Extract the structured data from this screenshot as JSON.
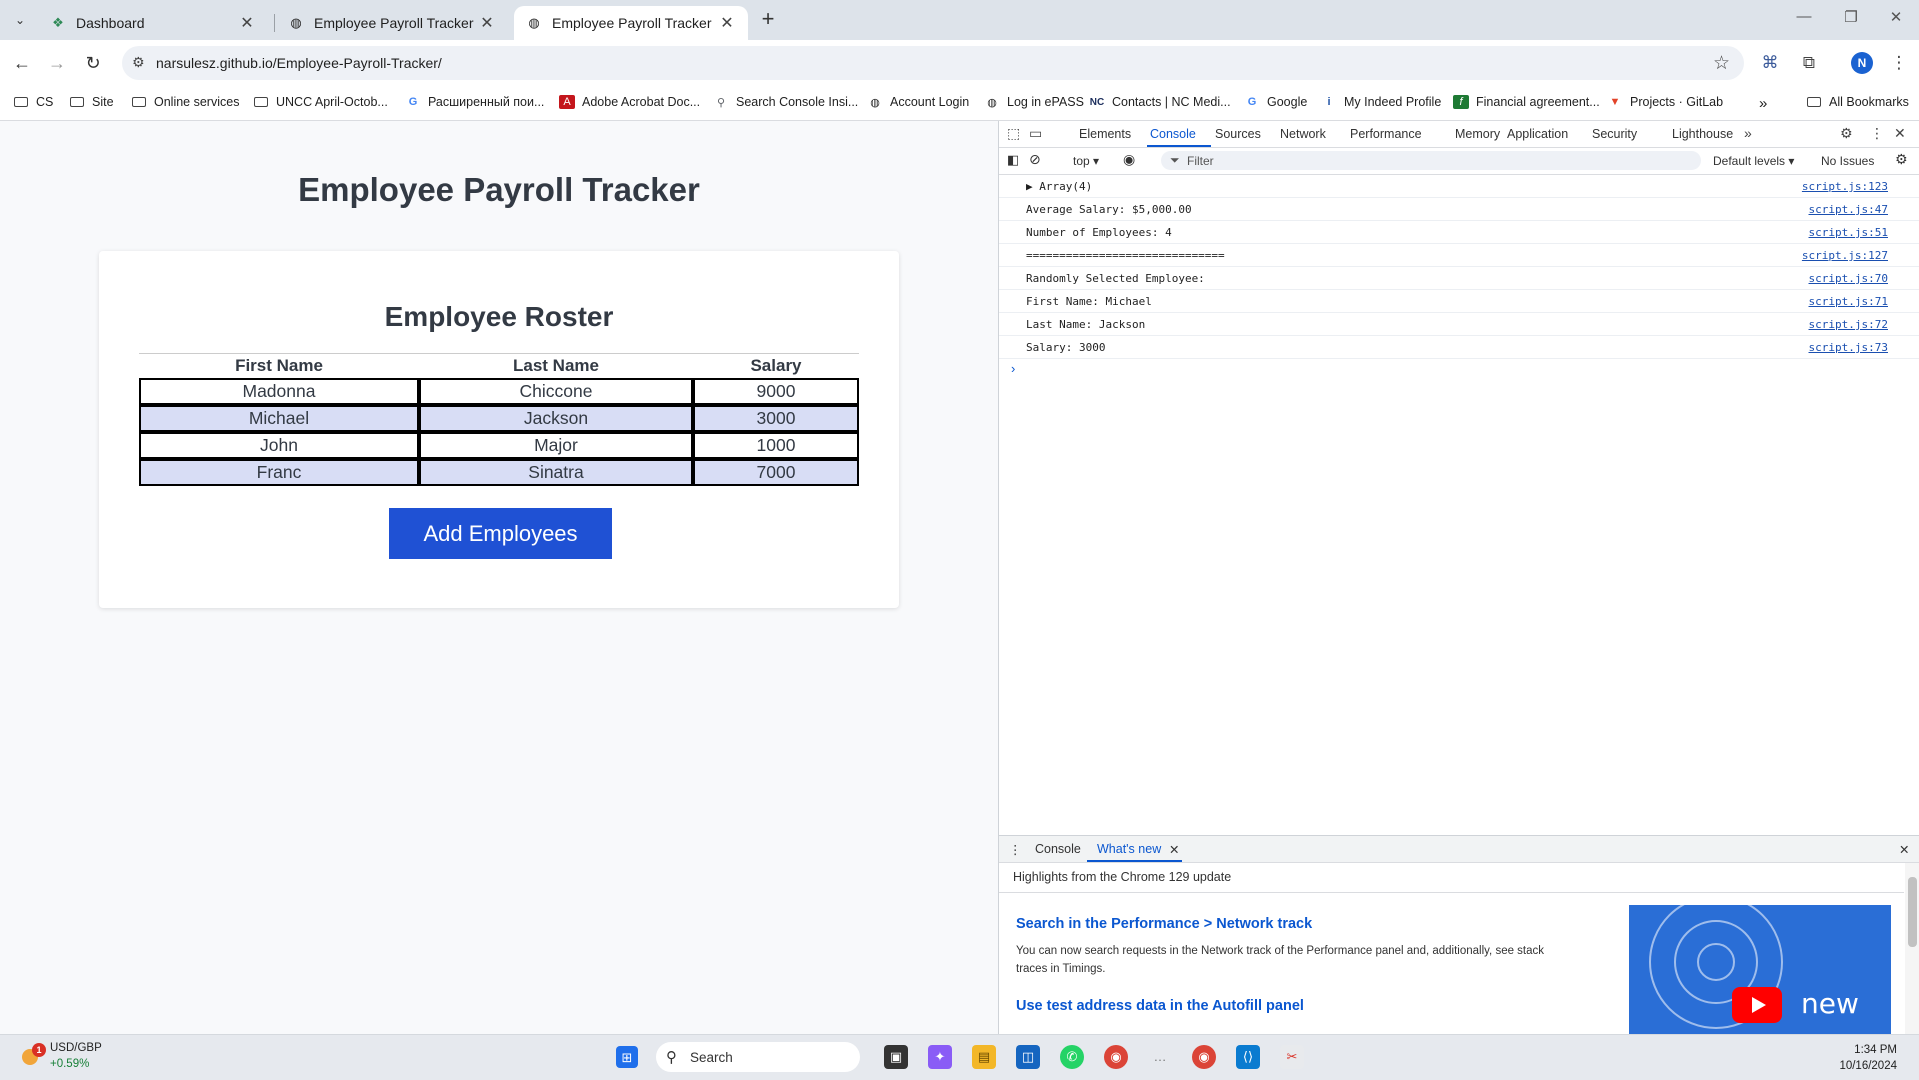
{
  "browser": {
    "tabs": [
      {
        "label": "Dashboard",
        "icon": "dashboard-favicon"
      },
      {
        "label": "Employee Payroll Tracker",
        "icon": "globe-icon"
      },
      {
        "label": "Employee Payroll Tracker",
        "icon": "globe-icon",
        "active": true
      }
    ],
    "url": "narsulesz.github.io/Employee-Payroll-Tracker/",
    "profile_initial": "N",
    "bookmarks": [
      "CS",
      "Site",
      "Online services",
      "UNCC April-Octob...",
      "Расширенный пои...",
      "Adobe Acrobat Doc...",
      "Search Console Insi...",
      "Account Login",
      "Log in ePASS",
      "Contacts | NC Medi...",
      "Google",
      "My Indeed Profile",
      "Financial agreement...",
      "Projects · GitLab"
    ],
    "all_bookmarks": "All Bookmarks"
  },
  "page": {
    "title": "Employee Payroll Tracker",
    "card_title": "Employee Roster",
    "columns": [
      "First Name",
      "Last Name",
      "Salary"
    ],
    "rows": [
      [
        "Madonna",
        "Chiccone",
        "9000"
      ],
      [
        "Michael",
        "Jackson",
        "3000"
      ],
      [
        "John",
        "Major",
        "1000"
      ],
      [
        "Franc",
        "Sinatra",
        "7000"
      ]
    ],
    "add_button": "Add Employees"
  },
  "devtools": {
    "tabs": [
      "Elements",
      "Console",
      "Sources",
      "Network",
      "Performance",
      "Memory",
      "Application",
      "Security",
      "Lighthouse"
    ],
    "active_tab": "Console",
    "context": "top",
    "filter_placeholder": "Filter",
    "levels": "Default levels",
    "issues": "No Issues",
    "console_lines": [
      {
        "msg": "▶ Array(4)",
        "src": "script.js:123"
      },
      {
        "msg": "Average Salary: $5,000.00",
        "src": "script.js:47"
      },
      {
        "msg": "Number of Employees: 4",
        "src": "script.js:51"
      },
      {
        "msg": "==============================",
        "src": "script.js:127"
      },
      {
        "msg": "Randomly Selected Employee:",
        "src": "script.js:70"
      },
      {
        "msg": "First Name: Michael",
        "src": "script.js:71"
      },
      {
        "msg": "Last Name: Jackson",
        "src": "script.js:72"
      },
      {
        "msg": "Salary: 3000",
        "src": "script.js:73"
      }
    ],
    "drawer": {
      "tabs": [
        "Console",
        "What's new"
      ],
      "header": "Highlights from the Chrome 129 update",
      "items": [
        {
          "title": "Search in the Performance > Network track",
          "body": "You can now search requests in the Network track of the Performance panel and, additionally, see stack traces in Timings."
        },
        {
          "title": "Use test address data in the Autofill panel"
        }
      ],
      "video_label": "new"
    }
  },
  "taskbar": {
    "ticker": "USD/GBP",
    "ticker_change": "+0.59%",
    "badge": "1",
    "search": "Search",
    "time": "1:34 PM",
    "date": "10/16/2024"
  }
}
